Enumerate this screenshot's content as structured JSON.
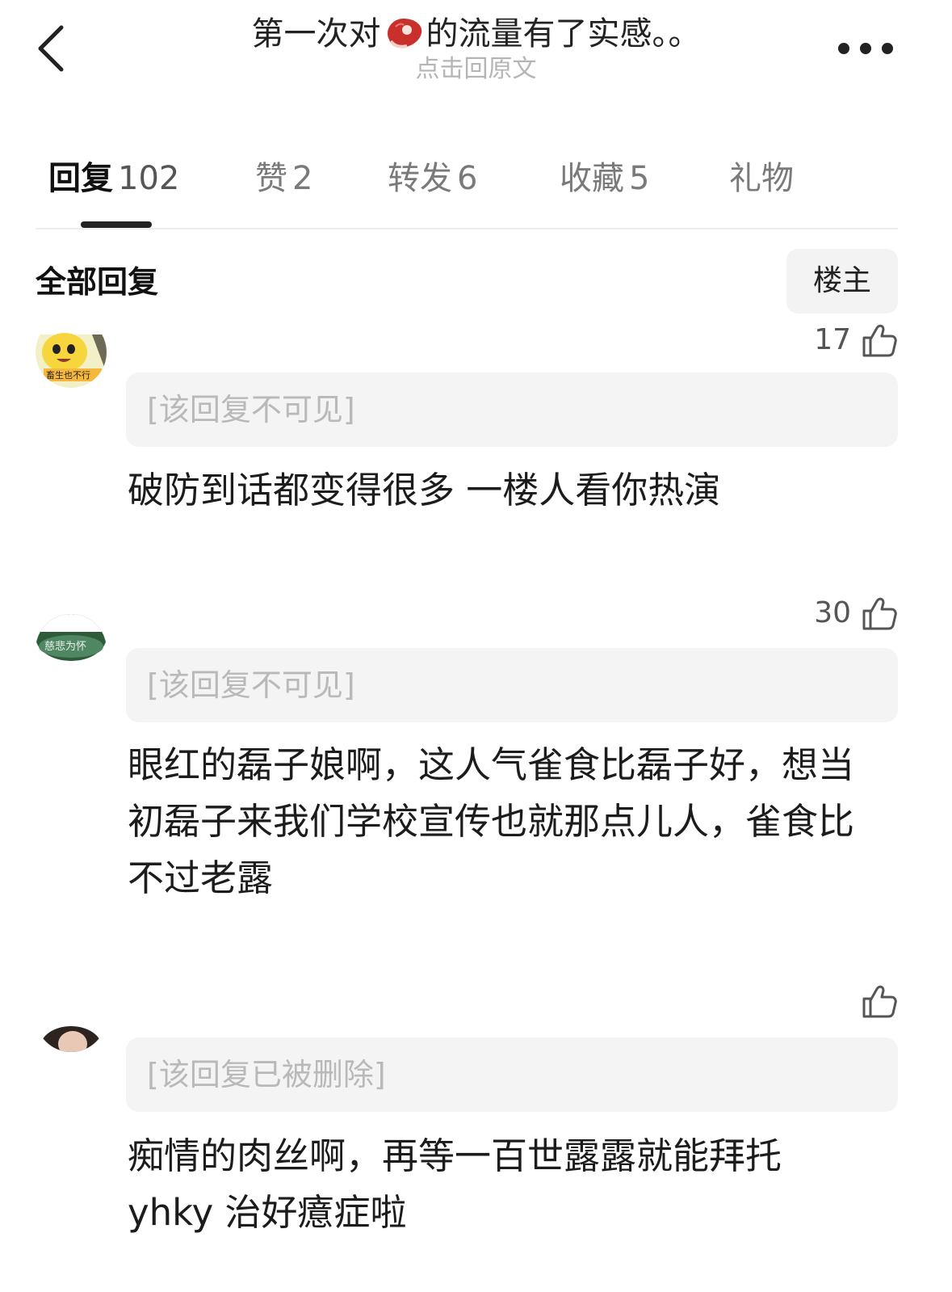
{
  "header": {
    "title_prefix": "第一次对",
    "title_suffix": "的流量有了实感。。",
    "subtitle": "点击回原文",
    "back_icon": "chevron-left-icon",
    "more_icon": "more-horizontal-icon"
  },
  "tabs": [
    {
      "label": "回复",
      "count": "102",
      "active": true
    },
    {
      "label": "赞",
      "count": "2"
    },
    {
      "label": "转发",
      "count": "6"
    },
    {
      "label": "收藏",
      "count": "5"
    },
    {
      "label": "礼物",
      "count": ""
    }
  ],
  "section": {
    "title": "全部回复",
    "filter_label": "楼主"
  },
  "comments": [
    {
      "avatar_text": "畜生也不行",
      "like_count": "17",
      "quote": "[该回复不可见]",
      "text": "破防到话都变得很多 一楼人看你热演"
    },
    {
      "avatar_text": "慈悲为怀",
      "like_count": "30",
      "quote": "[该回复不可见]",
      "text": "眼红的磊子娘啊，这人气雀食比磊子好，想当初磊子来我们学校宣传也就那点儿人，雀食比不过老露"
    },
    {
      "avatar_text": "",
      "like_count": "",
      "quote": "[该回复已被删除]",
      "text": "痴情的肉丝啊，再等一百世露露就能拜托 yhky 治好癔症啦"
    }
  ],
  "colors": {
    "accent": "#222222",
    "muted": "#b9b9b9",
    "quote_bg": "#f4f4f4",
    "meat": "#c9302c"
  }
}
